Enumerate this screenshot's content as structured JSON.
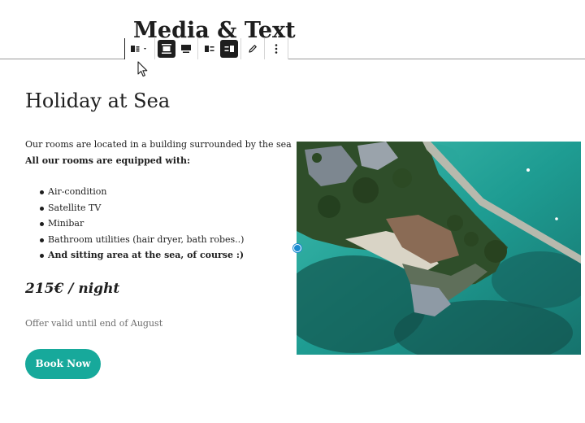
{
  "editor": {
    "page_title": "Media & Text"
  },
  "toolbar": {
    "buttons": [
      {
        "icon": "media-text-block-icon",
        "label": "Media & Text"
      },
      {
        "icon": "align-wide-icon",
        "label": "Wide width"
      },
      {
        "icon": "align-full-icon",
        "label": "Full width"
      },
      {
        "icon": "media-left-icon",
        "label": "Show media on left"
      },
      {
        "icon": "media-right-icon",
        "label": "Show media on right"
      },
      {
        "icon": "pencil-icon",
        "label": "Edit media"
      },
      {
        "icon": "more-options-icon",
        "label": "More options"
      }
    ],
    "active": [
      "align-wide-icon",
      "media-right-icon"
    ]
  },
  "content": {
    "heading": "Holiday at Sea",
    "intro_line": "Our rooms are located in a building surrounded by the sea",
    "intro_bold": "All our rooms are equipped with:",
    "features": [
      "Air-condition",
      "Satellite TV",
      "Minibar",
      "Bathroom utilities (hair dryer, bath robes..)",
      "And sitting area at the sea, of course :)"
    ],
    "price": "215€ / night",
    "offer_note": "Offer valid until end of August",
    "button_label": "Book Now"
  },
  "colors": {
    "accent_button": "#17a99b",
    "handle": "#1a8ad0",
    "text": "#1e1e1e",
    "muted_text": "#6c6c6c"
  }
}
